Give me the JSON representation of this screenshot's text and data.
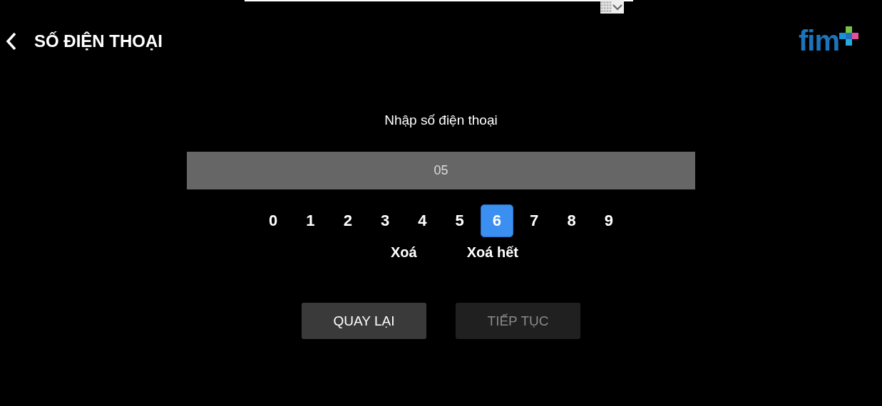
{
  "toolbar_dropdown": {
    "expanded": false
  },
  "header": {
    "title": "SỐ ĐIỆN THOẠI",
    "logo": "fim"
  },
  "prompt": "Nhập số điện thoại",
  "phone_field": {
    "value": "05"
  },
  "keypad": [
    {
      "label": "0",
      "selected": false
    },
    {
      "label": "1",
      "selected": false
    },
    {
      "label": "2",
      "selected": false
    },
    {
      "label": "3",
      "selected": false
    },
    {
      "label": "4",
      "selected": false
    },
    {
      "label": "5",
      "selected": false
    },
    {
      "label": "6",
      "selected": true
    },
    {
      "label": "7",
      "selected": false
    },
    {
      "label": "8",
      "selected": false
    },
    {
      "label": "9",
      "selected": false
    }
  ],
  "edit_actions": [
    "Xoá",
    "Xoá hết"
  ],
  "buttons": [
    {
      "label": "QUAY LẠI",
      "disabled": false
    },
    {
      "label": "TIẾP TỤC",
      "disabled": true
    }
  ]
}
